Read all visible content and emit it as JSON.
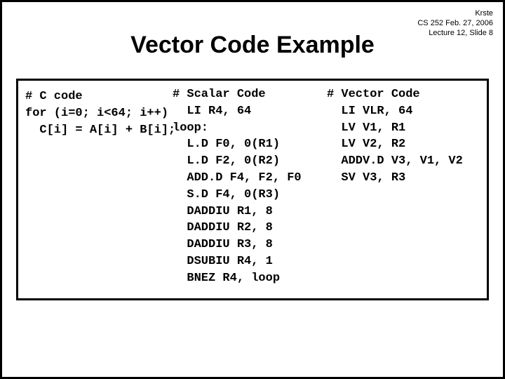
{
  "header": {
    "author": "Krste",
    "course": "CS 252 Feb. 27, 2006",
    "slide": "Lecture 12, Slide 8"
  },
  "title": "Vector Code Example",
  "code": {
    "c": "# C code\nfor (i=0; i<64; i++)\n  C[i] = A[i] + B[i];",
    "scalar": "# Scalar Code\n  LI R4, 64\nloop:\n  L.D F0, 0(R1)\n  L.D F2, 0(R2)\n  ADD.D F4, F2, F0\n  S.D F4, 0(R3)\n  DADDIU R1, 8\n  DADDIU R2, 8\n  DADDIU R3, 8\n  DSUBIU R4, 1\n  BNEZ R4, loop",
    "vector": "# Vector Code\n  LI VLR, 64\n  LV V1, R1\n  LV V2, R2\n  ADDV.D V3, V1, V2\n  SV V3, R3"
  }
}
